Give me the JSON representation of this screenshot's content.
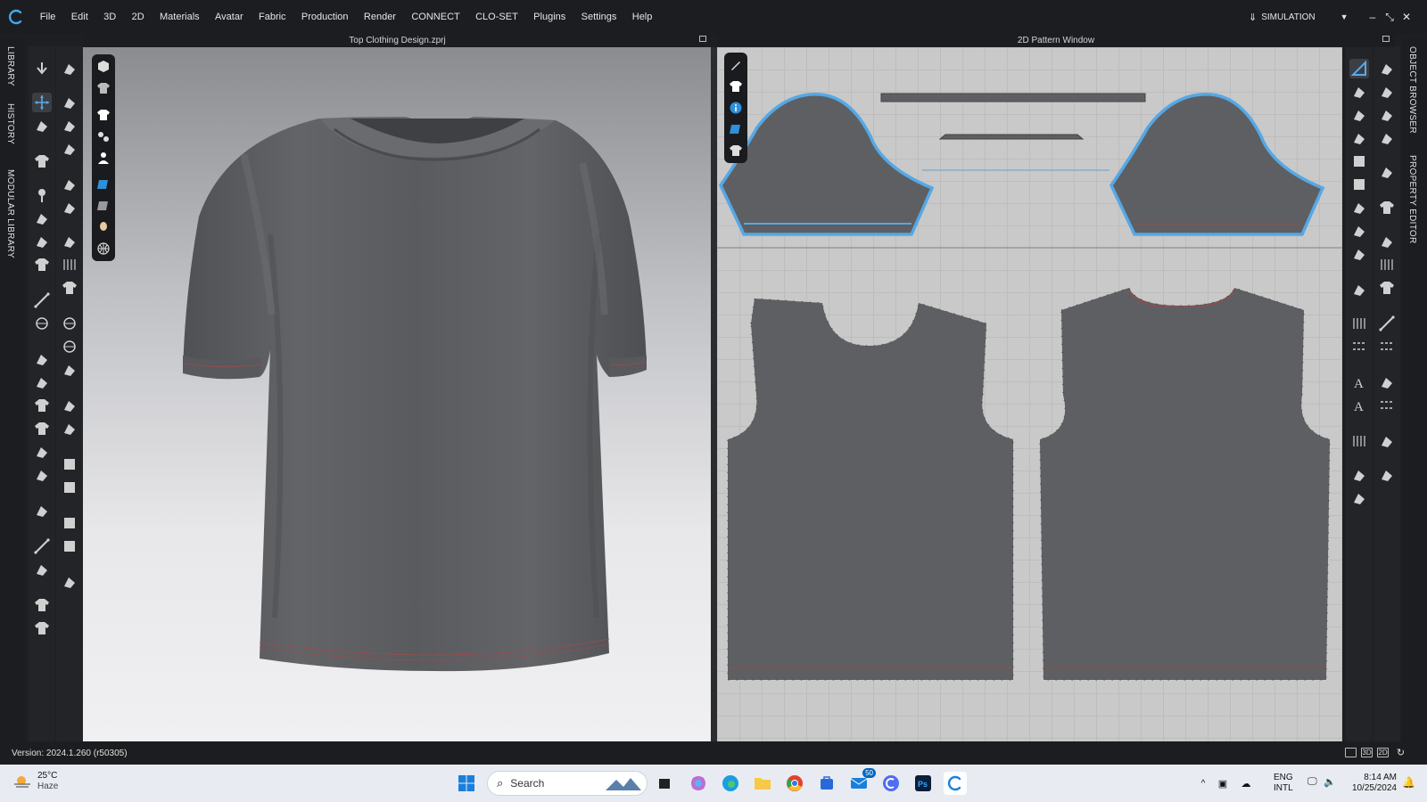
{
  "menubar": {
    "items": [
      "File",
      "Edit",
      "3D",
      "2D",
      "Materials",
      "Avatar",
      "Fabric",
      "Production",
      "Render",
      "CONNECT",
      "CLO-SET",
      "Plugins",
      "Settings",
      "Help"
    ],
    "mode_label": "SIMULATION",
    "logo_icon": "clo-logo-icon"
  },
  "left_tabs": [
    "LIBRARY",
    "HISTORY",
    "MODULAR LIBRARY"
  ],
  "right_tabs": [
    "OBJECT BROWSER",
    "PROPERTY EDITOR"
  ],
  "view3d": {
    "title": "Top Clothing Design.zprj",
    "garment_color": "#5d5e61"
  },
  "view2d": {
    "title": "2D Pattern Window",
    "pattern_color": "#5e5f62",
    "selected_outline_color": "#55a8e6",
    "stitch_color": "#b04040"
  },
  "status": {
    "version": "Version: 2024.1.260 (r50305)",
    "view_buttons": [
      "3D",
      "2D"
    ]
  },
  "taskbar": {
    "weather_temp": "25°C",
    "weather_cond": "Haze",
    "search_label": "Search",
    "mail_badge": "50",
    "lang_line1": "ENG",
    "lang_line2": "INTL",
    "time": "8:14 AM",
    "date": "10/25/2024"
  },
  "colors": {
    "accent": "#2f8fd8",
    "ui_dark": "#1c1d20"
  }
}
